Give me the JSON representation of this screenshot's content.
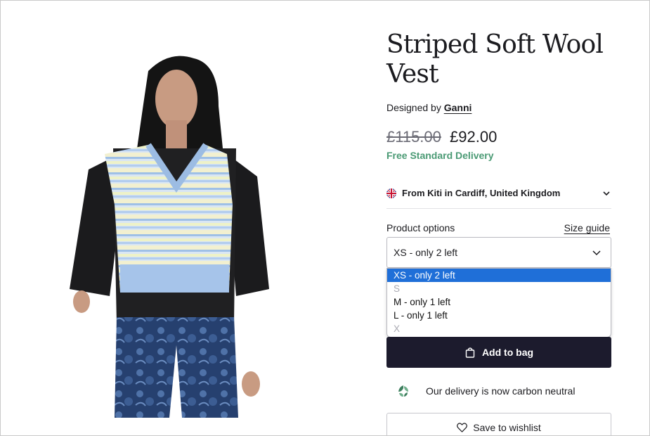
{
  "product": {
    "title": "Striped Soft Wool Vest",
    "designed_by_label": "Designed by",
    "designer": "Ganni",
    "price_original": "£115.00",
    "price_sale": "£92.00",
    "delivery_note": "Free Standard Delivery"
  },
  "seller": {
    "text": "From Kiti in Cardiff, United Kingdom",
    "flag_icon": "uk-flag-icon",
    "expand_icon": "chevron-down-icon"
  },
  "options": {
    "label": "Product options",
    "size_guide": "Size guide",
    "selected": "XS - only 2 left",
    "dropdown": [
      {
        "label": "XS - only 2 left",
        "state": "selected"
      },
      {
        "label": "S",
        "state": "disabled"
      },
      {
        "label": "M - only 1 left",
        "state": "enabled"
      },
      {
        "label": "L - only 1 left",
        "state": "enabled"
      },
      {
        "label": "X",
        "state": "disabled"
      }
    ]
  },
  "actions": {
    "add_to_bag": "Add to bag",
    "add_to_bag_icon": "shopping-bag-icon",
    "wishlist": "Save to wishlist",
    "wishlist_icon": "heart-icon"
  },
  "carbon": {
    "text": "Our delivery is now carbon neutral",
    "icon": "leaf-icon"
  },
  "colors": {
    "primary_button": "#1c1b2d",
    "delivery_green": "#4a9a74",
    "dropdown_highlight": "#1f6fd8"
  }
}
